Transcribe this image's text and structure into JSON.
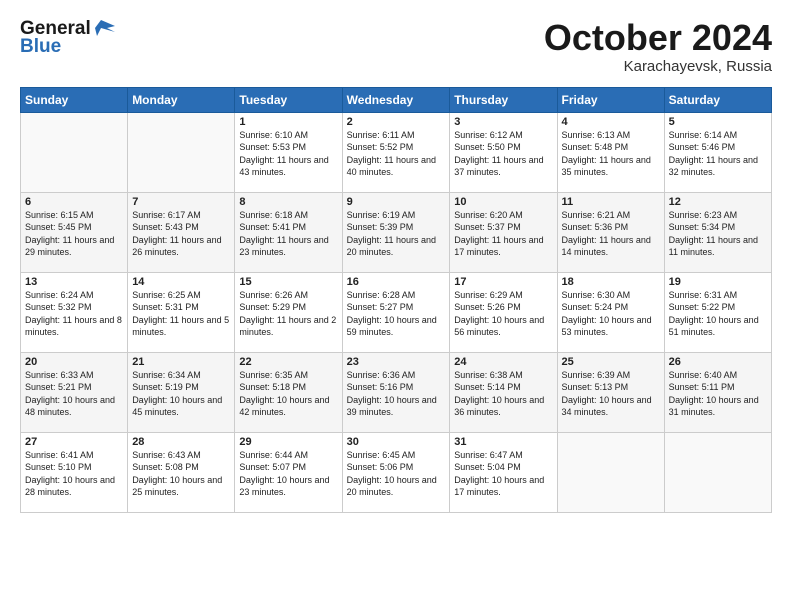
{
  "header": {
    "logo_line1": "General",
    "logo_line2": "Blue",
    "month": "October 2024",
    "location": "Karachayevsk, Russia"
  },
  "weekdays": [
    "Sunday",
    "Monday",
    "Tuesday",
    "Wednesday",
    "Thursday",
    "Friday",
    "Saturday"
  ],
  "weeks": [
    [
      {
        "day": "",
        "info": ""
      },
      {
        "day": "",
        "info": ""
      },
      {
        "day": "1",
        "info": "Sunrise: 6:10 AM\nSunset: 5:53 PM\nDaylight: 11 hours and 43 minutes."
      },
      {
        "day": "2",
        "info": "Sunrise: 6:11 AM\nSunset: 5:52 PM\nDaylight: 11 hours and 40 minutes."
      },
      {
        "day": "3",
        "info": "Sunrise: 6:12 AM\nSunset: 5:50 PM\nDaylight: 11 hours and 37 minutes."
      },
      {
        "day": "4",
        "info": "Sunrise: 6:13 AM\nSunset: 5:48 PM\nDaylight: 11 hours and 35 minutes."
      },
      {
        "day": "5",
        "info": "Sunrise: 6:14 AM\nSunset: 5:46 PM\nDaylight: 11 hours and 32 minutes."
      }
    ],
    [
      {
        "day": "6",
        "info": "Sunrise: 6:15 AM\nSunset: 5:45 PM\nDaylight: 11 hours and 29 minutes."
      },
      {
        "day": "7",
        "info": "Sunrise: 6:17 AM\nSunset: 5:43 PM\nDaylight: 11 hours and 26 minutes."
      },
      {
        "day": "8",
        "info": "Sunrise: 6:18 AM\nSunset: 5:41 PM\nDaylight: 11 hours and 23 minutes."
      },
      {
        "day": "9",
        "info": "Sunrise: 6:19 AM\nSunset: 5:39 PM\nDaylight: 11 hours and 20 minutes."
      },
      {
        "day": "10",
        "info": "Sunrise: 6:20 AM\nSunset: 5:37 PM\nDaylight: 11 hours and 17 minutes."
      },
      {
        "day": "11",
        "info": "Sunrise: 6:21 AM\nSunset: 5:36 PM\nDaylight: 11 hours and 14 minutes."
      },
      {
        "day": "12",
        "info": "Sunrise: 6:23 AM\nSunset: 5:34 PM\nDaylight: 11 hours and 11 minutes."
      }
    ],
    [
      {
        "day": "13",
        "info": "Sunrise: 6:24 AM\nSunset: 5:32 PM\nDaylight: 11 hours and 8 minutes."
      },
      {
        "day": "14",
        "info": "Sunrise: 6:25 AM\nSunset: 5:31 PM\nDaylight: 11 hours and 5 minutes."
      },
      {
        "day": "15",
        "info": "Sunrise: 6:26 AM\nSunset: 5:29 PM\nDaylight: 11 hours and 2 minutes."
      },
      {
        "day": "16",
        "info": "Sunrise: 6:28 AM\nSunset: 5:27 PM\nDaylight: 10 hours and 59 minutes."
      },
      {
        "day": "17",
        "info": "Sunrise: 6:29 AM\nSunset: 5:26 PM\nDaylight: 10 hours and 56 minutes."
      },
      {
        "day": "18",
        "info": "Sunrise: 6:30 AM\nSunset: 5:24 PM\nDaylight: 10 hours and 53 minutes."
      },
      {
        "day": "19",
        "info": "Sunrise: 6:31 AM\nSunset: 5:22 PM\nDaylight: 10 hours and 51 minutes."
      }
    ],
    [
      {
        "day": "20",
        "info": "Sunrise: 6:33 AM\nSunset: 5:21 PM\nDaylight: 10 hours and 48 minutes."
      },
      {
        "day": "21",
        "info": "Sunrise: 6:34 AM\nSunset: 5:19 PM\nDaylight: 10 hours and 45 minutes."
      },
      {
        "day": "22",
        "info": "Sunrise: 6:35 AM\nSunset: 5:18 PM\nDaylight: 10 hours and 42 minutes."
      },
      {
        "day": "23",
        "info": "Sunrise: 6:36 AM\nSunset: 5:16 PM\nDaylight: 10 hours and 39 minutes."
      },
      {
        "day": "24",
        "info": "Sunrise: 6:38 AM\nSunset: 5:14 PM\nDaylight: 10 hours and 36 minutes."
      },
      {
        "day": "25",
        "info": "Sunrise: 6:39 AM\nSunset: 5:13 PM\nDaylight: 10 hours and 34 minutes."
      },
      {
        "day": "26",
        "info": "Sunrise: 6:40 AM\nSunset: 5:11 PM\nDaylight: 10 hours and 31 minutes."
      }
    ],
    [
      {
        "day": "27",
        "info": "Sunrise: 6:41 AM\nSunset: 5:10 PM\nDaylight: 10 hours and 28 minutes."
      },
      {
        "day": "28",
        "info": "Sunrise: 6:43 AM\nSunset: 5:08 PM\nDaylight: 10 hours and 25 minutes."
      },
      {
        "day": "29",
        "info": "Sunrise: 6:44 AM\nSunset: 5:07 PM\nDaylight: 10 hours and 23 minutes."
      },
      {
        "day": "30",
        "info": "Sunrise: 6:45 AM\nSunset: 5:06 PM\nDaylight: 10 hours and 20 minutes."
      },
      {
        "day": "31",
        "info": "Sunrise: 6:47 AM\nSunset: 5:04 PM\nDaylight: 10 hours and 17 minutes."
      },
      {
        "day": "",
        "info": ""
      },
      {
        "day": "",
        "info": ""
      }
    ]
  ]
}
